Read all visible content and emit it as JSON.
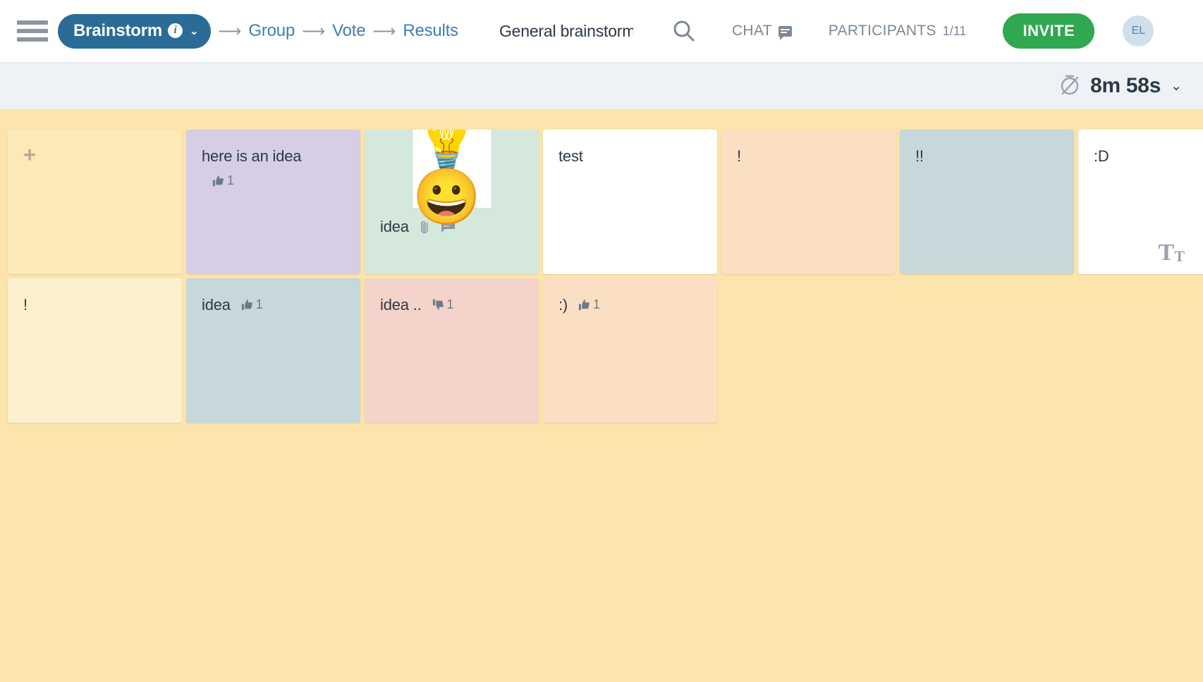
{
  "header": {
    "menu_icon": "hamburger-icon",
    "phase_pill": {
      "label": "Brainstorm",
      "info_glyph": "i",
      "caret_glyph": "⌄"
    },
    "breadcrumb": [
      {
        "label": "Group"
      },
      {
        "label": "Vote"
      },
      {
        "label": "Results"
      }
    ],
    "arrow_glyph": "⟶",
    "board_title": "General brainstorming",
    "search_icon": "search-icon",
    "chat": {
      "label": "CHAT",
      "icon": "chat-bubble-icon"
    },
    "participants": {
      "label": "PARTICIPANTS",
      "count": "1/11"
    },
    "invite": {
      "label": "INVITE",
      "color": "#2fa84f"
    },
    "avatar": {
      "initials": "EL",
      "bg": "#cfe0ec",
      "fg": "#4a87b8"
    }
  },
  "timer": {
    "icon": "stopwatch-off-icon",
    "value": "8m 58s",
    "caret_glyph": "⌄"
  },
  "board": {
    "bg_color": "#fce5ac",
    "text_size_icon": {
      "big": "T",
      "small": "T"
    },
    "add_card": {
      "plus_glyph": "+",
      "color": "#fbe9b8"
    },
    "cards": [
      {
        "text": "here is an idea",
        "color": "#d5cee5",
        "votes": {
          "type": "up",
          "count": "1"
        }
      },
      {
        "text": "idea",
        "color": "#d4e8dc",
        "media": "💡😀",
        "attachment_icon": "paperclip-icon",
        "comment_icon": "comment-icon"
      },
      {
        "text": "test",
        "color": "#ffffff"
      },
      {
        "text": "!",
        "color": "#fbdfc2"
      },
      {
        "text": "!!",
        "color": "#c6d8da"
      },
      {
        "text": ":D",
        "color": "#ffffff"
      },
      {
        "text": "!",
        "color": "#fdf0cf"
      },
      {
        "text": "idea",
        "color": "#c6d8da",
        "votes": {
          "type": "up",
          "count": "1"
        }
      },
      {
        "text": "idea ..",
        "color": "#f4d3cb",
        "votes": {
          "type": "down",
          "count": "1"
        }
      },
      {
        "text": ":)",
        "color": "#fbdfc2",
        "votes": {
          "type": "up",
          "count": "1"
        }
      }
    ]
  }
}
